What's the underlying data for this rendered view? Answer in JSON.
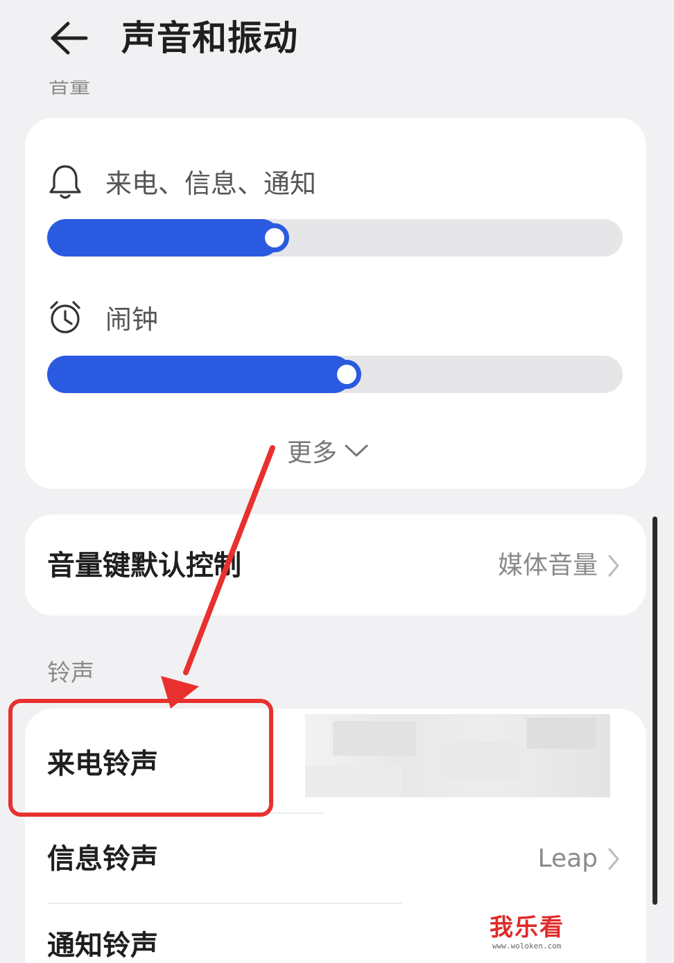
{
  "header": {
    "title": "声音和振动",
    "back_icon": "arrow-left-icon",
    "section_label_partial": "音量"
  },
  "volume": {
    "ring": {
      "label": "来电、信息、通知",
      "icon": "bell-icon",
      "level_percent": 40.5
    },
    "alarm": {
      "label": "闹钟",
      "icon": "alarm-clock-icon",
      "level_percent": 53
    },
    "more_label": "更多",
    "more_icon": "chevron-down-icon"
  },
  "volume_keys": {
    "label": "音量键默认控制",
    "value": "媒体音量",
    "chevron_icon": "chevron-right-icon"
  },
  "ringtones": {
    "group_title": "铃声",
    "items": [
      {
        "label": "来电铃声",
        "value": ""
      },
      {
        "label": "信息铃声",
        "value": "Leap"
      },
      {
        "label": "通知铃声",
        "value": ""
      }
    ]
  },
  "annotation": {
    "color": "#e8312f"
  },
  "watermark": {
    "main": "我乐看",
    "sub": "www.woloken.com"
  },
  "colors": {
    "accent": "#2a5ae0",
    "background": "#f1f1f3",
    "card": "#ffffff"
  }
}
